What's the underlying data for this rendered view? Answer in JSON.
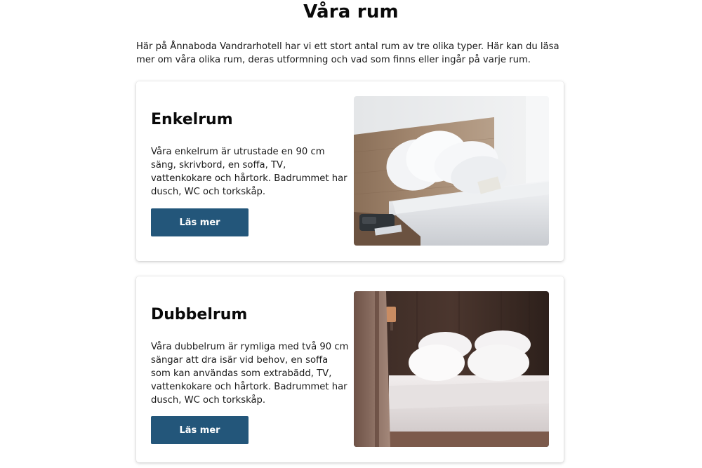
{
  "page": {
    "title": "Våra rum",
    "intro": "Här på Ånnaboda Vandrarhotell har vi ett stort antal rum av tre olika typer. Här kan du läsa mer om våra olika rum, deras utformning och vad som finns eller ingår på varje rum."
  },
  "rooms": [
    {
      "title": "Enkelrum",
      "description": "Våra enkelrum är utrustade en 90 cm säng, skrivbord, en soffa, TV, vattenkokare och hårtork. Badrummet har dusch, WC och torkskåp.",
      "button_label": "Läs mer",
      "image": "single-room-photo"
    },
    {
      "title": "Dubbelrum",
      "description": "Våra dubbelrum är rymliga med två 90 cm sängar att dra isär vid behov, en soffa som kan användas som extrabädd, TV, vattenkokare och hårtork. Badrummet har dusch, WC och torkskåp.",
      "button_label": "Läs mer",
      "image": "double-room-photo"
    }
  ],
  "colors": {
    "button": "#23567a",
    "text": "#1a1a1a"
  }
}
